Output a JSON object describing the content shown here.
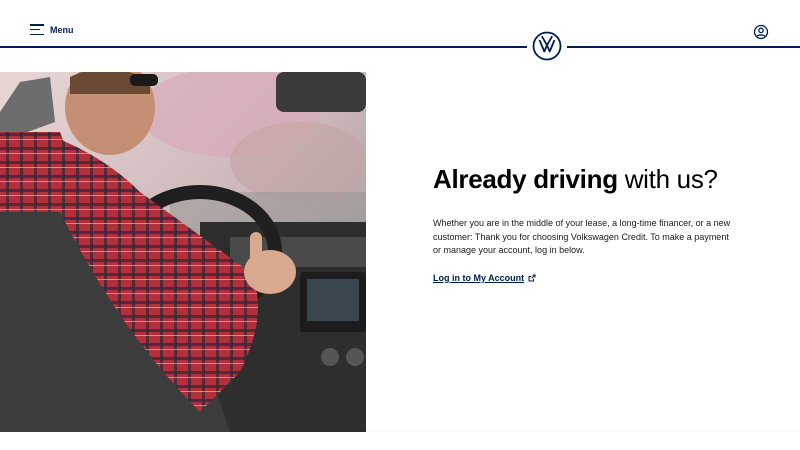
{
  "header": {
    "menu_label": "Menu",
    "menu_icon": "hamburger-icon",
    "logo": "vw-logo",
    "account_icon": "user-account-icon"
  },
  "hero": {
    "image_description": "Man in red plaid shirt and sunglasses driving a car, hand on steering wheel"
  },
  "main": {
    "headline_bold": "Already driving",
    "headline_light": " with us?",
    "body": "Whether you are in the middle of your lease, a long-time financer, or a new customer: Thank you for choosing Volkswagen Credit. To make a payment or manage your account, log in below.",
    "link_label": "Log in to My Account",
    "link_icon": "external-link-icon"
  },
  "colors": {
    "brand_navy": "#001e50",
    "text_black": "#000000",
    "background": "#ffffff"
  }
}
